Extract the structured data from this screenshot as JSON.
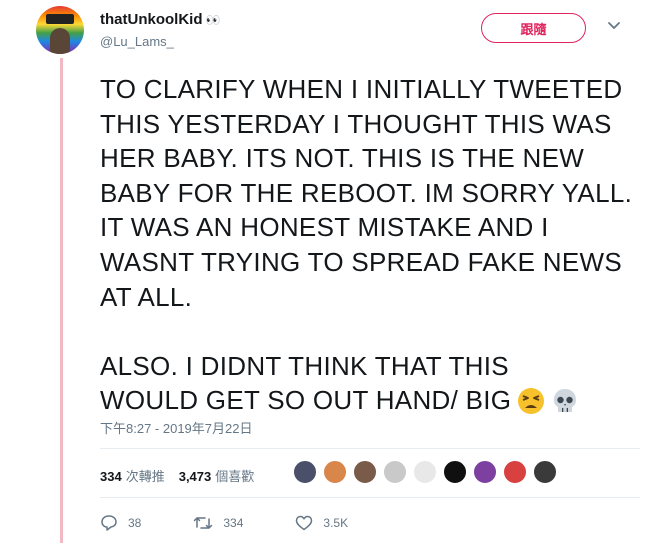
{
  "author": {
    "display_name": "thatUnkoolKid",
    "name_emoji": "👀",
    "handle": "@Lu_Lams_"
  },
  "follow_button_label": "跟隨",
  "tweet": {
    "lines_para1": [
      "TO CLARIFY WHEN I INITIALLY TWEETED",
      "THIS YESTERDAY I THOUGHT THIS WAS",
      "HER BABY. ITS NOT. THIS IS THE NEW",
      "BABY FOR THE REBOOT. IM SORRY YALL.",
      "IT WAS AN HONEST MISTAKE AND I",
      "WASNT TRYING TO SPREAD FAKE NEWS",
      "AT ALL."
    ],
    "lines_para2": [
      "ALSO. I DIDNT THINK THAT THIS",
      "WOULD GET SO OUT HAND/ BIG"
    ],
    "trailing_emojis": [
      "tired-face-icon",
      "skull-icon"
    ]
  },
  "timestamp": "下午8:27 - 2019年7月22日",
  "stats": {
    "retweets_count": "334",
    "retweets_label": "次轉推",
    "likes_count": "3,473",
    "likes_label": "個喜歡"
  },
  "liker_colors": [
    "#4a4f6a",
    "#d9864a",
    "#7a5a48",
    "#c9c9c9",
    "#e8e8e8",
    "#101010",
    "#7d3fa0",
    "#d94040",
    "#3a3a3a"
  ],
  "actions": {
    "reply_count": "38",
    "retweet_count": "334",
    "like_count": "3.5K"
  },
  "colors": {
    "accent": "#e0245e",
    "thread_line": "#f2b9c4",
    "muted_text": "#657786"
  }
}
